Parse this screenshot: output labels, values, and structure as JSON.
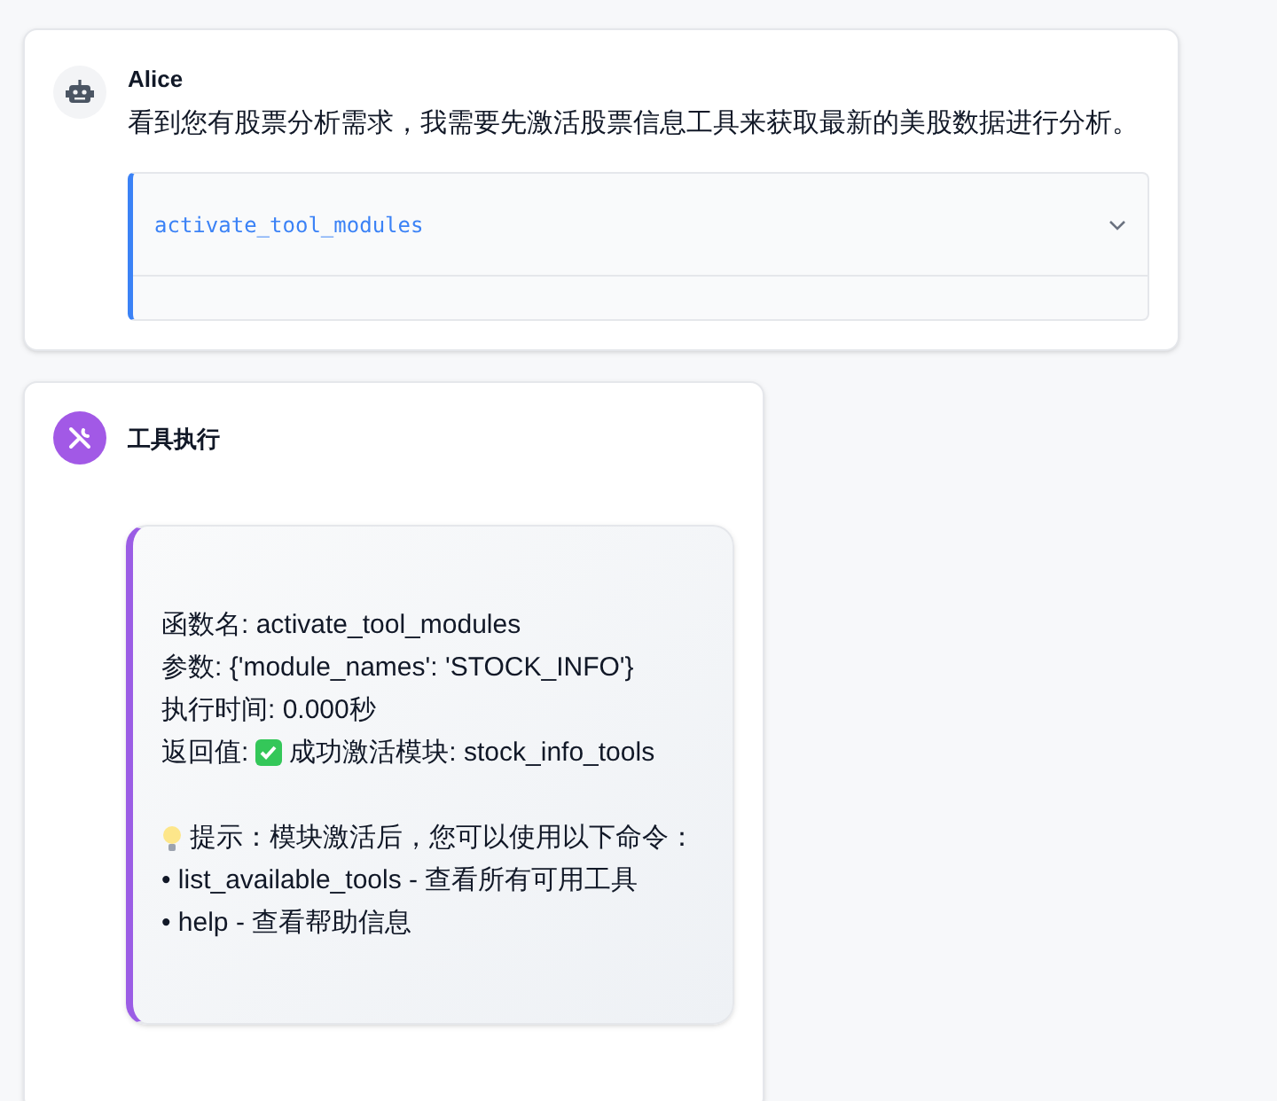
{
  "messages": [
    {
      "kind": "assistant",
      "sender": "Alice",
      "text": "看到您有股票分析需求，我需要先激活股票信息工具来获取最新的美股数据进行分析。",
      "tool_call": {
        "name": "activate_tool_modules",
        "expanded": false
      }
    },
    {
      "kind": "tool",
      "sender": "工具执行",
      "lines": [
        {
          "kind": "text",
          "text": "函数名: activate_tool_modules"
        },
        {
          "kind": "text",
          "text": "参数: {'module_names': 'STOCK_INFO'}"
        },
        {
          "kind": "text",
          "text": "执行时间: 0.000秒"
        },
        {
          "kind": "result",
          "prefix": "返回值:",
          "text": "成功激活模块: stock_info_tools"
        },
        {
          "kind": "blank"
        },
        {
          "kind": "tip",
          "text": "提示：模块激活后，您可以使用以下命令："
        },
        {
          "kind": "text",
          "text": "• list_available_tools - 查看所有可用工具"
        },
        {
          "kind": "text",
          "text": "• help - 查看帮助信息"
        }
      ]
    }
  ]
}
